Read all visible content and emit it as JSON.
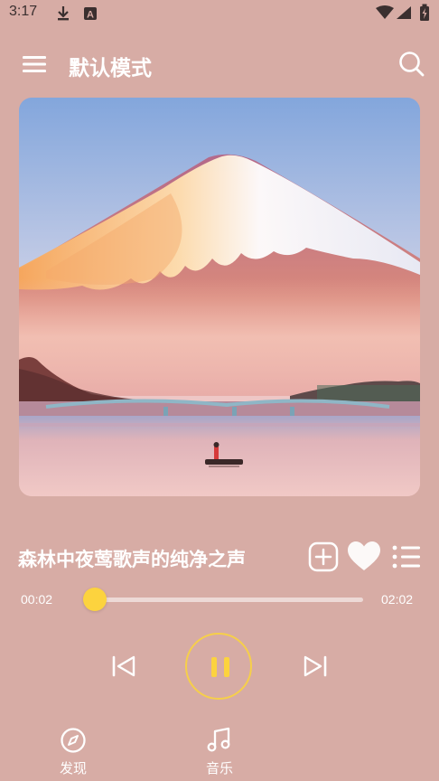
{
  "status_bar": {
    "time": "3:17",
    "icons": [
      "download-icon",
      "a-badge-icon",
      "wifi-icon",
      "signal-icon",
      "battery-icon"
    ]
  },
  "header": {
    "title": "默认模式",
    "icons": [
      "menu-icon",
      "search-icon"
    ]
  },
  "artwork": {
    "icon": "album-cover-image"
  },
  "now_playing": {
    "title": "森林中夜莺歌声的纯净之声",
    "elapsed": "00:02",
    "total": "02:02",
    "progress_fraction": 0.016,
    "actions": [
      "add-icon",
      "heart-icon",
      "playlist-icon"
    ]
  },
  "controls": {
    "state": "playing",
    "icons": [
      "previous-icon",
      "pause-icon",
      "next-icon"
    ]
  },
  "bottom_nav": {
    "items": [
      {
        "label": "发现",
        "icon": "compass-icon"
      },
      {
        "label": "音乐",
        "icon": "music-note-icon"
      }
    ]
  },
  "colors": {
    "background": "#d7aca5",
    "accent": "#fcd33e",
    "text": "#ffffff"
  }
}
